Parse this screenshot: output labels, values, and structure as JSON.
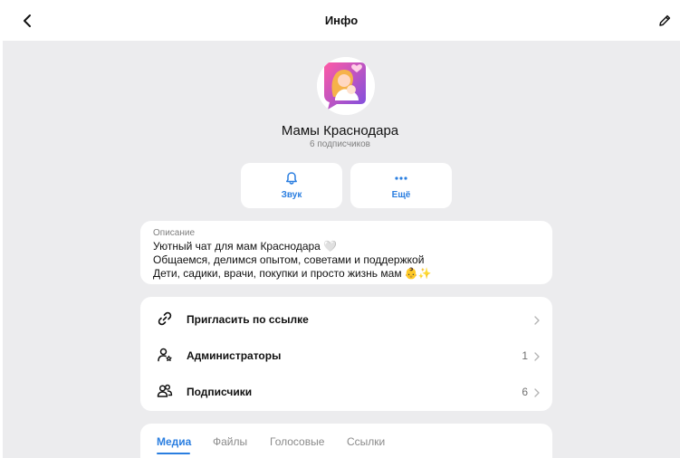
{
  "header": {
    "title": "Инфо",
    "back_icon": "chevron-left-icon",
    "edit_icon": "pencil-icon"
  },
  "channel": {
    "name": "Мамы Краснодара",
    "subscribers": "6 подписчиков",
    "avatar_icon": "mother-and-baby-avatar"
  },
  "actions": [
    {
      "label": "Звук",
      "icon": "bell-icon"
    },
    {
      "label": "Ещё",
      "icon": "more-dots-icon"
    }
  ],
  "description": {
    "label": "Описание",
    "lines": [
      "Уютный чат для мам Краснодара 🤍",
      "Общаемся, делимся опытом, советами и поддержкой",
      "Дети, садики, врачи, покупки и просто жизнь мам 👶✨"
    ]
  },
  "menu": [
    {
      "label": "Пригласить по ссылке",
      "count": "",
      "icon": "link-icon"
    },
    {
      "label": "Администраторы",
      "count": "1",
      "icon": "admin-icon"
    },
    {
      "label": "Подписчики",
      "count": "6",
      "icon": "users-icon"
    }
  ],
  "tabs": [
    "Медиа",
    "Файлы",
    "Голосовые",
    "Ссылки"
  ],
  "colors": {
    "accent": "#2a7ee0",
    "background": "#ececee",
    "card": "#ffffff",
    "secondary_text": "#808080"
  }
}
